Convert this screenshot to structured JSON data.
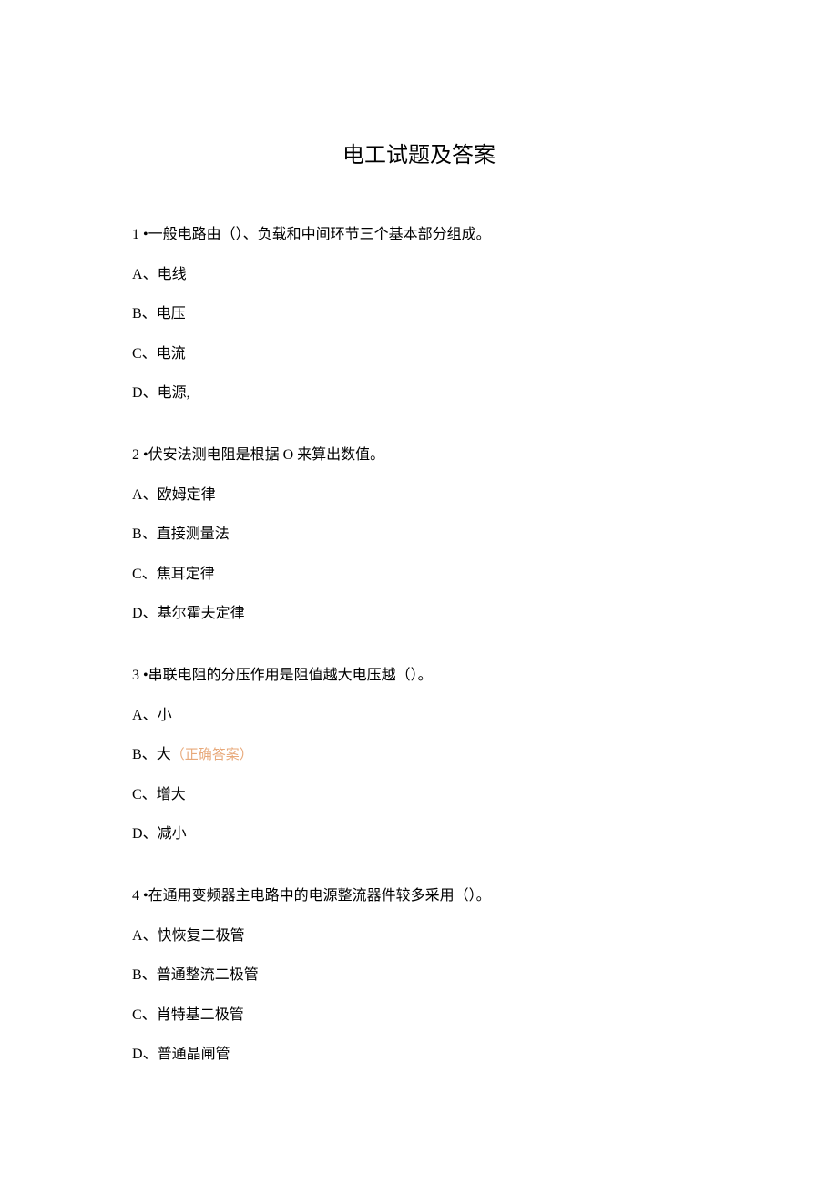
{
  "title": "电工试题及答案",
  "questions": [
    {
      "number": "1",
      "bullet": "•",
      "text": "一般电路由（）、负载和中间环节三个基本部分组成。",
      "options": [
        {
          "letter": "A",
          "sep": "、",
          "text": "电线",
          "correct": false
        },
        {
          "letter": "B",
          "sep": "、",
          "text": "电压",
          "correct": false
        },
        {
          "letter": "C",
          "sep": "、",
          "text": "电流",
          "correct": false
        },
        {
          "letter": "D",
          "sep": "、",
          "text": "电源,",
          "correct": false
        }
      ]
    },
    {
      "number": "2",
      "bullet": "•",
      "text": "伏安法测电阻是根据 O 来算出数值。",
      "options": [
        {
          "letter": "A",
          "sep": "、",
          "text": "欧姆定律",
          "correct": false
        },
        {
          "letter": "B",
          "sep": "、",
          "text": "直接测量法",
          "correct": false
        },
        {
          "letter": "C",
          "sep": "、",
          "text": "焦耳定律",
          "correct": false
        },
        {
          "letter": "D",
          "sep": "、",
          "text": "基尔霍夫定律",
          "correct": false
        }
      ]
    },
    {
      "number": "3",
      "bullet": "•",
      "text": "串联电阻的分压作用是阻值越大电压越（）。",
      "options": [
        {
          "letter": "A",
          "sep": "、",
          "text": "小",
          "correct": false
        },
        {
          "letter": "B",
          "sep": "、",
          "text": "大",
          "correct": true
        },
        {
          "letter": "C",
          "sep": "、",
          "text": "增大",
          "correct": false
        },
        {
          "letter": "D",
          "sep": "、",
          "text": "减小",
          "correct": false
        }
      ]
    },
    {
      "number": "4",
      "bullet": "•",
      "text": "在通用变频器主电路中的电源整流器件较多采用（）。",
      "options": [
        {
          "letter": "A",
          "sep": "、",
          "text": "快恢复二极管",
          "correct": false
        },
        {
          "letter": "B",
          "sep": "、",
          "text": "普通整流二极管",
          "correct": false
        },
        {
          "letter": "C",
          "sep": "、",
          "text": "肖特基二极管",
          "correct": false
        },
        {
          "letter": "D",
          "sep": "、",
          "text": "普通晶闸管",
          "correct": false
        }
      ]
    }
  ],
  "correctLabel": "（正确答案）"
}
